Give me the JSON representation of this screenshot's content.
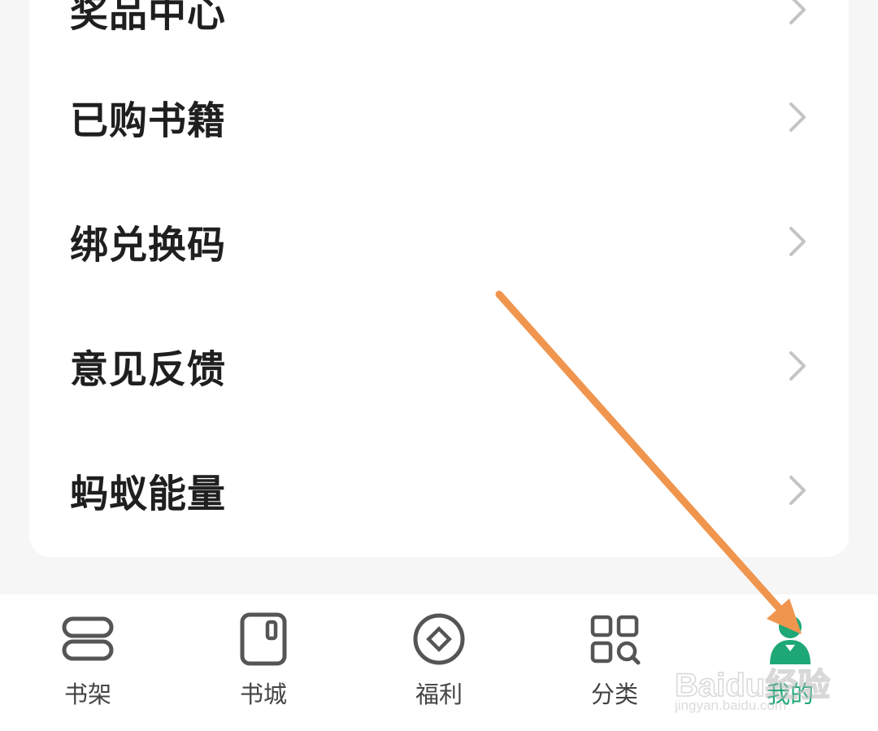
{
  "menu": {
    "items": [
      {
        "label": "奖品中心"
      },
      {
        "label": "已购书籍"
      },
      {
        "label": "绑兑换码"
      },
      {
        "label": "意见反馈"
      },
      {
        "label": "蚂蚁能量"
      }
    ]
  },
  "tabbar": {
    "tabs": [
      {
        "label": "书架",
        "icon": "bookshelf-icon"
      },
      {
        "label": "书城",
        "icon": "bookstore-icon"
      },
      {
        "label": "福利",
        "icon": "coin-icon"
      },
      {
        "label": "分类",
        "icon": "category-icon"
      },
      {
        "label": "我的",
        "icon": "profile-icon",
        "active": true
      }
    ]
  },
  "watermark": {
    "logo": "Baidu经验",
    "url": "jingyan.baidu.com"
  },
  "colors": {
    "accent": "#1ea876",
    "annotation_arrow": "#f0954e",
    "text": "#1f1f1f",
    "tab_text": "#444444"
  }
}
